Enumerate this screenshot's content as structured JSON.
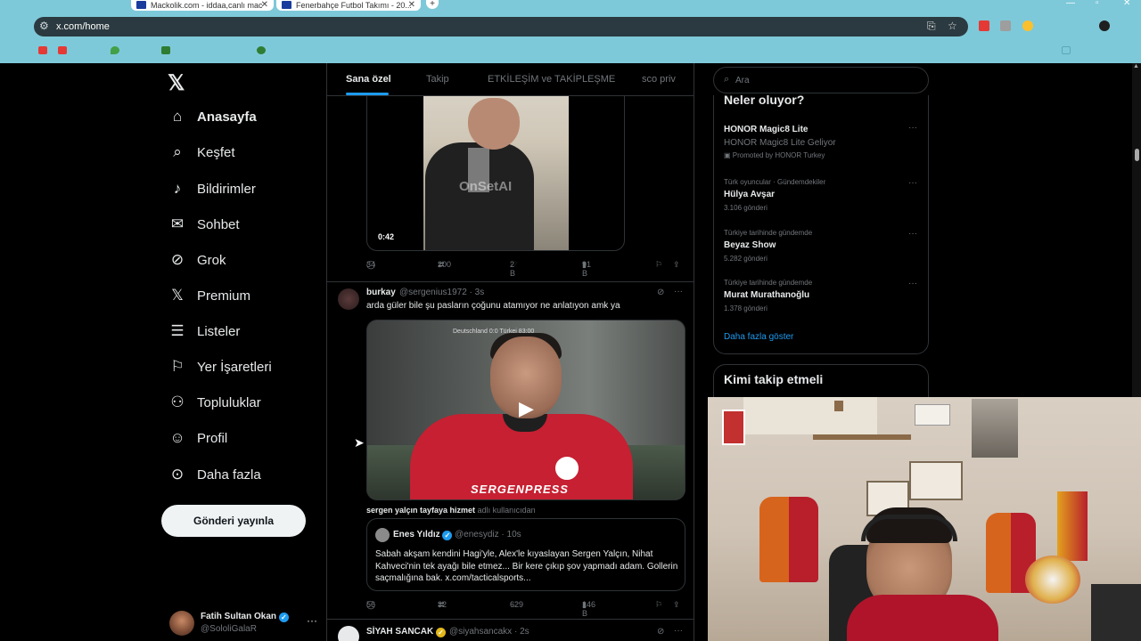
{
  "browser": {
    "tabs": [
      {
        "title": "Mackolik.com - iddaa,canlı mac"
      },
      {
        "title": "Fenerbahçe Futbol Takımı - 20..."
      }
    ],
    "url": "x.com/home"
  },
  "sidebar": {
    "items": [
      {
        "label": "Anasayfa",
        "icon": "home-icon"
      },
      {
        "label": "Keşfet",
        "icon": "search-icon"
      },
      {
        "label": "Bildirimler",
        "icon": "bell-icon"
      },
      {
        "label": "Sohbet",
        "icon": "mail-icon"
      },
      {
        "label": "Grok",
        "icon": "grok-icon"
      },
      {
        "label": "Premium",
        "icon": "x-icon"
      },
      {
        "label": "Listeler",
        "icon": "list-icon"
      },
      {
        "label": "Yer İşaretleri",
        "icon": "bookmark-icon"
      },
      {
        "label": "Topluluklar",
        "icon": "people-icon"
      },
      {
        "label": "Profil",
        "icon": "person-icon"
      },
      {
        "label": "Daha fazla",
        "icon": "more-circle-icon"
      }
    ],
    "post_button": "Gönderi yayınla",
    "account": {
      "name": "Fatih Sultan Okan",
      "handle": "@SololiGalaR"
    }
  },
  "feed": {
    "tabs": [
      "Sana özel",
      "Takip",
      "ETKİLEŞİM ve TAKİPLEŞME",
      "sco priv"
    ],
    "tweet1": {
      "watermark": "OnSetAI",
      "duration": "0:42",
      "replies": "34",
      "retweets": "200",
      "likes": "2 B",
      "views": "91 B"
    },
    "tweet2": {
      "name": "burkay",
      "handle": "@sergenius1972 · 3s",
      "text": "arda güler bile şu pasların çoğunu atamıyor ne anlatıyon amk ya",
      "video_score": "Deutschland 0:0 Türkei  83:00",
      "video_brand": "SERGENPRESS",
      "context_bold": "sergen yalçın tayfaya hizmet",
      "context_rest": " adlı kullanıcıdan",
      "quote": {
        "name": "Enes Yıldız",
        "handle": "@enesydiz · 10s",
        "text": "Sabah akşam kendini Hagi'yle, Alex'le kıyaslayan Sergen Yalçın, Nihat Kahveci'nin tek ayağı bile etmez... Bir kere çıkıp şov yapmadı adam. Gollerin saçmalığına bak. x.com/tacticalsports..."
      },
      "replies": "56",
      "retweets": "32",
      "likes": "629",
      "views": "146 B"
    },
    "tweet3": {
      "name": "SİYAH SANCAK",
      "handle": "@siyahsancakx · 2s"
    }
  },
  "right": {
    "search_placeholder": "Ara",
    "trends_title": "Neler oluyor?",
    "trends": [
      {
        "meta": "",
        "title": "HONOR Magic8 Lite",
        "sub": "HONOR Magic8 Lite Geliyor",
        "promo": "Promoted by HONOR Turkey"
      },
      {
        "meta": "Türk oyuncular · Gündemdekiler",
        "title": "Hülya Avşar",
        "sub": "3.106 gönderi"
      },
      {
        "meta": "Türkiye tarihinde gündemde",
        "title": "Beyaz Show",
        "sub": "5.282 gönderi"
      },
      {
        "meta": "Türkiye tarihinde gündemde",
        "title": "Murat Murathanoğlu",
        "sub": "1.378 gönderi"
      }
    ],
    "show_more": "Daha fazla göster",
    "follow_title": "Kimi takip etmeli"
  },
  "colors": {
    "accent": "#1d9bf0",
    "background": "#000000",
    "chrome": "#7ec9d9",
    "border": "#2f3336"
  }
}
